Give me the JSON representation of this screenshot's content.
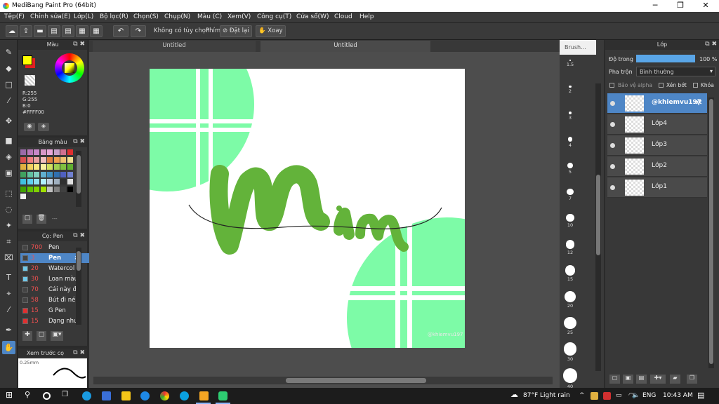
{
  "app": {
    "title": "MediBang Paint Pro (64bit)"
  },
  "window_controls": {
    "minimize": "─",
    "maximize": "❐",
    "close": "✕"
  },
  "menu": [
    "Tệp(F)",
    "Chỉnh sửa(E)",
    "Lớp(L)",
    "Bộ lọc(R)",
    "Chọn(S)",
    "Chụp(N)",
    "Màu (C)",
    "Xem(V)",
    "Công cụ(T)",
    "Cửa sổ(W)",
    "Cloud",
    "Help"
  ],
  "toolbar": {
    "option_label": "Không có tùy chọn",
    "keys_label": "Phím",
    "reset_label": "Đặt lại",
    "rotate_label": "Xoay",
    "icons": [
      "cloud-icon",
      "upload-icon",
      "chat-icon",
      "page-icon",
      "page-icon",
      "grid-icon",
      "grid-icon",
      "undo-icon",
      "redo-icon"
    ]
  },
  "color_panel": {
    "title": "Màu",
    "r": "R:255",
    "g": "G:255",
    "b": "B:0",
    "hex": "#FFFF00",
    "primary_color": "#FFFF00",
    "secondary_color": "#E02020"
  },
  "palette_panel": {
    "title": "Bảng màu",
    "colors": [
      "#9a6aa8",
      "#b878b8",
      "#c888c8",
      "#d898c8",
      "#e8a8d8",
      "#c8a0c8",
      "#d07090",
      "#e03030",
      "#d85050",
      "#f08080",
      "#e8a0a0",
      "#f0c0c0",
      "#e08040",
      "#f0a050",
      "#f0c070",
      "#f0e090",
      "#e0b040",
      "#f0d060",
      "#f8e880",
      "#f8f0a0",
      "#d0e060",
      "#a0d050",
      "#80c040",
      "#60b030",
      "#40a060",
      "#60c0a0",
      "#80d0c0",
      "#60b0d0",
      "#4090c0",
      "#3070b0",
      "#5060c0",
      "#7080d0",
      "#40c0e0",
      "#60d0f0",
      "#90e0f0",
      "#b0f0ff",
      "#c0d0e0",
      "#a0b0c0",
      "#303030",
      "#e0e0e0",
      "#40a000",
      "#60c000",
      "#80d000",
      "#a0e000",
      "#c0c0c0",
      "#808080",
      "#404040",
      "#000000",
      "#f0f0f0"
    ],
    "footer_text": "---"
  },
  "brush_panel": {
    "title": "Cọ: Pen",
    "items": [
      {
        "size": "700",
        "name": "Pen",
        "color": "#444444"
      },
      {
        "size": "3",
        "name": "Pen",
        "color": "#444444"
      },
      {
        "size": "20",
        "name": "Watercol",
        "color": "#70c8e8"
      },
      {
        "size": "30",
        "name": "Loan màu",
        "color": "#70c8e8"
      },
      {
        "size": "70",
        "name": "Cái này đi",
        "color": "#444444"
      },
      {
        "size": "58",
        "name": "Bút đi né",
        "color": "#444444"
      },
      {
        "size": "15",
        "name": "G Pen",
        "color": "#e03030"
      },
      {
        "size": "15",
        "name": "Dạng nhu",
        "color": "#e03030"
      }
    ],
    "selected_index": 1
  },
  "preview_panel": {
    "title": "Xem trước cọ",
    "size": "0.25mm"
  },
  "tabs": [
    {
      "label": "Untitled"
    },
    {
      "label": "Untitled"
    }
  ],
  "artwork": {
    "word": "Mim",
    "green": "#7dfba7",
    "lettering": "#63b33a",
    "watermark": "@khiemvu197"
  },
  "brush_size_panel": {
    "title": "Brush...",
    "sizes": [
      "1.5",
      "2",
      "3",
      "4",
      "5",
      "7",
      "10",
      "12",
      "15",
      "20",
      "25",
      "30",
      "40"
    ]
  },
  "layer_panel": {
    "title": "Lớp",
    "opacity_label": "Độ trong",
    "opacity_value": "100 %",
    "opacity_level": 1.0,
    "blend_label": "Pha trộn",
    "blend_value": "Bình thường",
    "protect_alpha": "Bảo vệ alpha",
    "clipping": "Xén bớt",
    "lock": "Khóa",
    "layers": [
      {
        "name": "@khiemvu197",
        "selected": true
      },
      {
        "name": "Lớp4",
        "selected": false
      },
      {
        "name": "Lớp3",
        "selected": false
      },
      {
        "name": "Lớp2",
        "selected": false
      },
      {
        "name": "Lớp1",
        "selected": false
      }
    ]
  },
  "taskbar": {
    "weather": "87°F  Light rain",
    "language": "ENG",
    "time": "10:43 AM"
  }
}
